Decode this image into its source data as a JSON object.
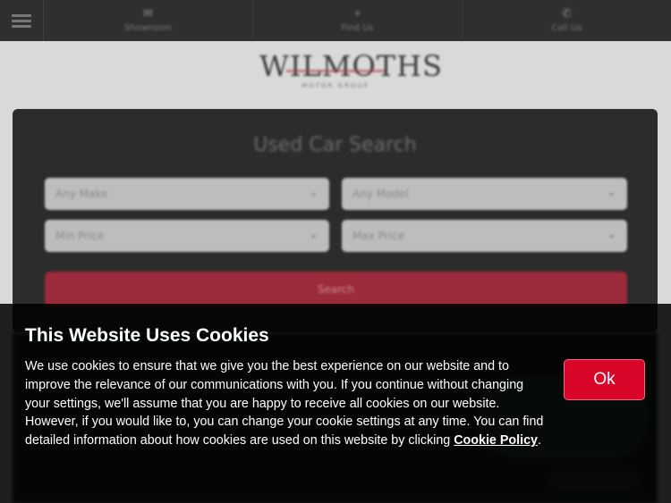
{
  "nav": {
    "items": [
      {
        "icon": "envelope-icon",
        "glyph": "✉",
        "label": "Showroom"
      },
      {
        "icon": "location-icon",
        "glyph": "⌖",
        "label": "Find Us"
      },
      {
        "icon": "phone-icon",
        "glyph": "✆",
        "label": "Call Us"
      }
    ]
  },
  "logo": {
    "text": "WILMOTHS",
    "tagline": "MOTOR GROUP"
  },
  "search": {
    "title": "Used Car Search",
    "make": "Any Make",
    "model": "Any Model",
    "min_price": "Min Price",
    "max_price": "Max Price",
    "submit_label": "Search"
  },
  "cookie": {
    "title": "This Website Uses Cookies",
    "body": "We use cookies to ensure that we give you the best experience on our website and to improve the relevance of our communications with you. If you continue without changing your settings, we'll assume that you are happy to receive all cookies on our website. However, if you would like to, you can change your cookie settings at any time. You can find detailed information about how cookies are used on this website by clicking ",
    "link_label": "Cookie Policy",
    "after_link": ".",
    "ok_label": "Ok"
  },
  "colors": {
    "accent": "#d9062a",
    "nav_bg": "#2f2f2f",
    "panel_bg": "#2c2c2c"
  }
}
